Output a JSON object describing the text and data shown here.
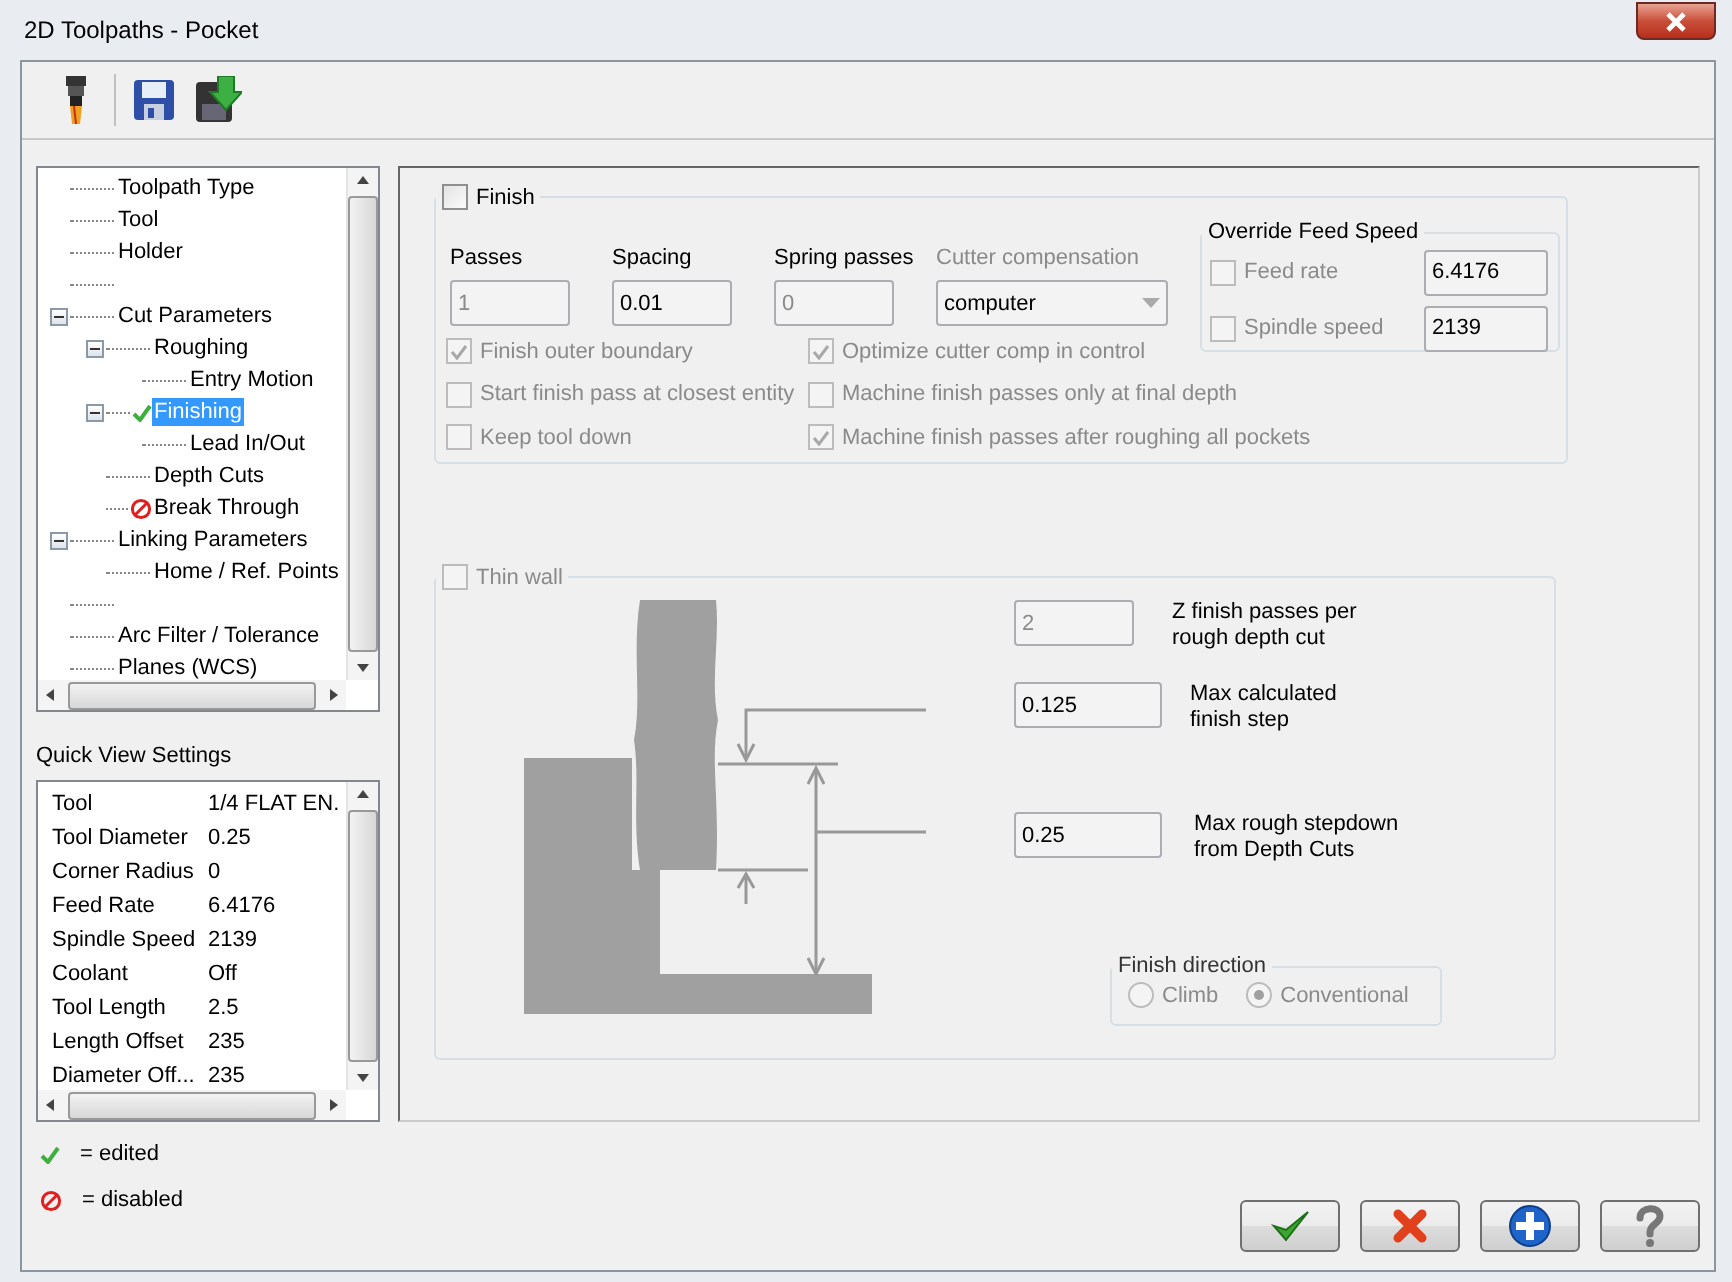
{
  "window": {
    "title": "2D Toolpaths - Pocket"
  },
  "tree": {
    "items": [
      {
        "kind": "node",
        "label": "Toolpath Type",
        "selected": false
      },
      {
        "kind": "node",
        "label": "Tool",
        "selected": false
      },
      {
        "kind": "node",
        "label": "Holder",
        "selected": false
      },
      {
        "kind": "blank",
        "selected": false
      },
      {
        "kind": "node",
        "label": "Cut Parameters",
        "selected": false,
        "expanded": true,
        "children": [
          {
            "kind": "node",
            "label": "Roughing",
            "selected": false,
            "expanded": true,
            "children": [
              {
                "kind": "node",
                "label": "Entry Motion",
                "selected": false
              }
            ]
          },
          {
            "kind": "edited",
            "label": "Finishing",
            "selected": true,
            "expanded": true,
            "children": [
              {
                "kind": "node",
                "label": "Lead In/Out",
                "selected": false
              }
            ]
          },
          {
            "kind": "node",
            "label": "Depth Cuts",
            "selected": false
          },
          {
            "kind": "disabled",
            "label": "Break Through",
            "selected": false
          }
        ]
      },
      {
        "kind": "node",
        "label": "Linking Parameters",
        "selected": false,
        "expanded": true,
        "children": [
          {
            "kind": "node",
            "label": "Home / Ref. Points",
            "selected": false
          }
        ]
      },
      {
        "kind": "blank",
        "selected": false
      },
      {
        "kind": "node",
        "label": "Arc Filter / Tolerance",
        "selected": false
      },
      {
        "kind": "node",
        "label": "Planes (WCS)",
        "selected": false
      }
    ]
  },
  "quick_view": {
    "title": "Quick View Settings",
    "rows": [
      {
        "label": "Tool",
        "value": "1/4 FLAT EN."
      },
      {
        "label": "Tool Diameter",
        "value": "0.25"
      },
      {
        "label": "Corner Radius",
        "value": "0"
      },
      {
        "label": "Feed Rate",
        "value": "6.4176"
      },
      {
        "label": "Spindle Speed",
        "value": "2139"
      },
      {
        "label": "Coolant",
        "value": "Off"
      },
      {
        "label": "Tool Length",
        "value": "2.5"
      },
      {
        "label": "Length Offset",
        "value": "235"
      },
      {
        "label": "Diameter Off...",
        "value": "235"
      }
    ]
  },
  "legend": [
    {
      "kind": "edited",
      "label": "= edited"
    },
    {
      "kind": "disabled",
      "label": "= disabled"
    }
  ],
  "finish": {
    "label": "Finish",
    "checked": false,
    "fields": [
      {
        "label": "Passes",
        "value": "1",
        "disabled": true
      },
      {
        "label": "Spacing",
        "value": "0.01",
        "disabled": false
      },
      {
        "label": "Spring passes",
        "value": "0",
        "disabled": true
      }
    ],
    "cutter_compensation": {
      "label": "Cutter compensation",
      "value": "computer",
      "disabled": true
    },
    "options": [
      {
        "label": "Finish outer boundary",
        "checked": true,
        "disabled": true
      },
      {
        "label": "Start finish pass at closest entity",
        "checked": false,
        "disabled": true
      },
      {
        "label": "Keep tool down",
        "checked": false,
        "disabled": true
      },
      {
        "label": "Optimize cutter comp in control",
        "checked": true,
        "disabled": true
      },
      {
        "label": "Machine finish passes only at final depth",
        "checked": false,
        "disabled": true
      },
      {
        "label": "Machine finish passes after roughing all pockets",
        "checked": true,
        "disabled": true
      }
    ],
    "override": {
      "title": "Override Feed Speed",
      "rows": [
        {
          "label": "Feed rate",
          "checked": false,
          "disabled": true,
          "value": "6.4176"
        },
        {
          "label": "Spindle speed",
          "checked": false,
          "disabled": true,
          "value": "2139"
        }
      ]
    }
  },
  "thin_wall": {
    "label": "Thin wall",
    "checked": false,
    "disabled": true,
    "fields": [
      {
        "value": "2",
        "label": "Z finish passes per\nrough depth cut",
        "disabled": true
      },
      {
        "value": "0.125",
        "label": "Max calculated\nfinish step",
        "disabled": false
      },
      {
        "value": "0.25",
        "label": "Max rough stepdown\nfrom Depth Cuts",
        "disabled": false
      }
    ],
    "finish_direction": {
      "title": "Finish direction",
      "disabled": true,
      "options": [
        {
          "label": "Climb",
          "selected": false
        },
        {
          "label": "Conventional",
          "selected": true
        }
      ]
    }
  }
}
